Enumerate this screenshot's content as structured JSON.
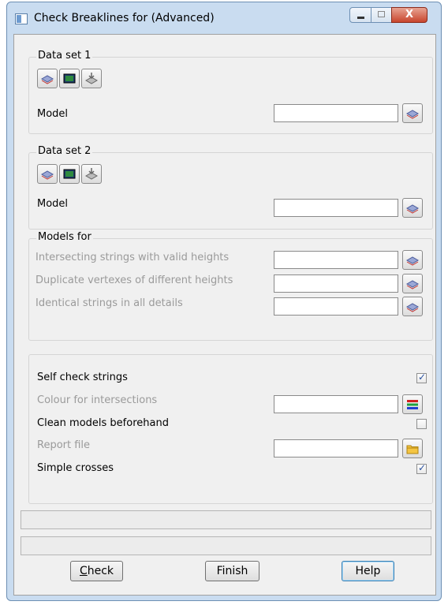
{
  "window": {
    "title": "Check Breaklines for (Advanced)",
    "close_glyph": "X"
  },
  "dataset1": {
    "title": "Data set 1",
    "model_label": "Model",
    "model_value": "",
    "toolbar_icons": [
      "layers-icon",
      "screen-icon",
      "layers-add-icon"
    ]
  },
  "dataset2": {
    "title": "Data set 2",
    "model_label": "Model",
    "model_value": "",
    "toolbar_icons": [
      "layers-icon",
      "screen-icon",
      "layers-add-icon"
    ]
  },
  "models_for": {
    "title": "Models for",
    "rows": [
      {
        "label": "Intersecting strings with valid heights",
        "value": ""
      },
      {
        "label": "Duplicate vertexes of different heights",
        "value": ""
      },
      {
        "label": "Identical strings in all details",
        "value": ""
      }
    ]
  },
  "options": {
    "self_check_label": "Self check strings",
    "self_check_checked": true,
    "colour_label": "Colour for intersections",
    "colour_value": "",
    "clean_models_label": "Clean models beforehand",
    "clean_models_checked": false,
    "report_file_label": "Report file",
    "report_file_value": "",
    "simple_crosses_label": "Simple crosses",
    "simple_crosses_checked": true,
    "check_mark": "✓"
  },
  "status": {
    "line1": "",
    "line2": ""
  },
  "buttons": {
    "check_mnemonic": "C",
    "check_rest": "heck",
    "finish": "Finish",
    "help": "Help"
  }
}
